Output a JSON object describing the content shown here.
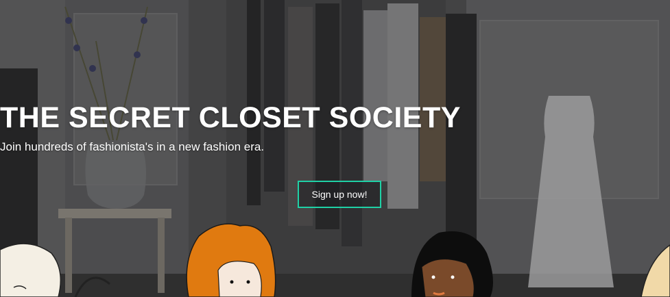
{
  "hero": {
    "title": "THE SECRET CLOSET SOCIETY",
    "subtitle": "Join hundreds of fashionista's in a new fashion era.",
    "cta_label": "Sign up now!"
  },
  "colors": {
    "accent": "#1fd1a6",
    "text": "#ffffff",
    "hair_orange": "#e07a10"
  },
  "icons": [
    "vase-with-lavender",
    "clothing-rack",
    "white-dress",
    "illustrated-women"
  ]
}
